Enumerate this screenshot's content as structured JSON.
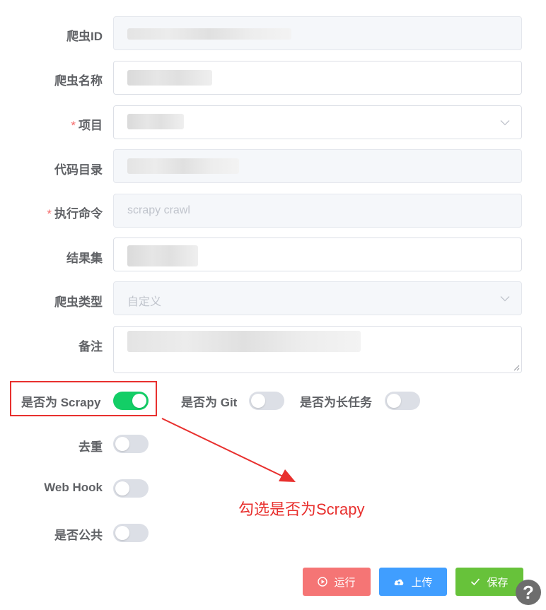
{
  "form": {
    "crawler_id": {
      "label": "爬虫ID"
    },
    "crawler_name": {
      "label": "爬虫名称"
    },
    "project": {
      "label": "项目",
      "required": "*"
    },
    "code_dir": {
      "label": "代码目录"
    },
    "command": {
      "label": "执行命令",
      "required": "*",
      "placeholder": "scrapy crawl"
    },
    "result_set": {
      "label": "结果集"
    },
    "crawler_type": {
      "label": "爬虫类型",
      "value": "自定义"
    },
    "remark": {
      "label": "备注"
    }
  },
  "switches": {
    "is_scrapy": {
      "label": "是否为 Scrapy",
      "state": "on"
    },
    "is_git": {
      "label": "是否为 Git",
      "state": "off"
    },
    "is_long_task": {
      "label": "是否为长任务",
      "state": "off"
    },
    "dedup": {
      "label": "去重",
      "state": "off"
    },
    "webhook": {
      "label": "Web Hook",
      "state": "off"
    },
    "is_public": {
      "label": "是否公共",
      "state": "off"
    }
  },
  "annotation": {
    "text": "勾选是否为Scrapy",
    "color": "#e8302e"
  },
  "buttons": {
    "run": {
      "label": "运行",
      "color": "#f57575"
    },
    "upload": {
      "label": "上传",
      "color": "#409eff"
    },
    "save": {
      "label": "保存",
      "color": "#67c23a"
    }
  },
  "help": {
    "label": "?"
  },
  "colors": {
    "switch_on": "#13ce66",
    "switch_off": "#dcdfe6",
    "required": "#f56c6c"
  }
}
